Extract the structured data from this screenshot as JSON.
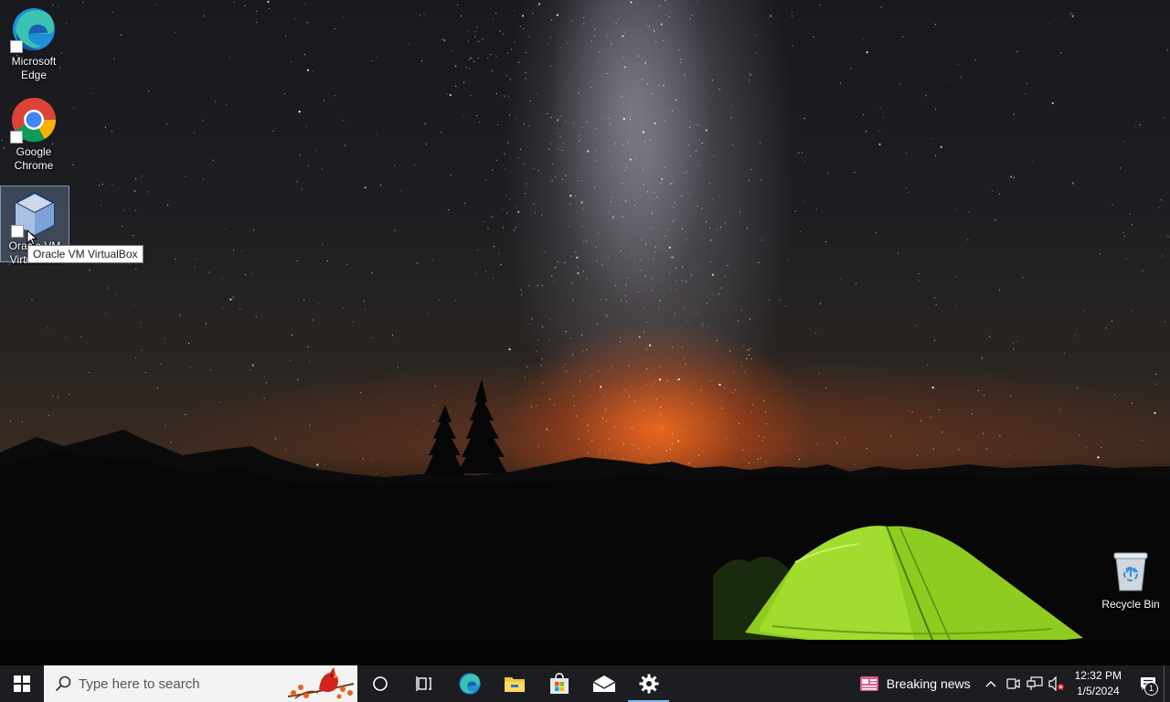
{
  "desktop": {
    "icons": [
      {
        "name": "edge",
        "label_line1": "Microsoft",
        "label_line2": "Edge"
      },
      {
        "name": "chrome",
        "label_line1": "Google",
        "label_line2": "Chrome"
      },
      {
        "name": "virtualbox",
        "label_line1": "Oracle VM",
        "label_line2": "VirtualBox"
      }
    ],
    "tooltip": "Oracle VM VirtualBox",
    "recycle_bin": "Recycle Bin"
  },
  "taskbar": {
    "search_placeholder": "Type here to search",
    "pinned": [
      "cortana-icon",
      "task-view-icon",
      "edge-icon",
      "file-explorer-icon",
      "store-icon",
      "mail-icon",
      "settings-icon"
    ],
    "news": "Breaking news",
    "time": "12:32 PM",
    "date": "1/5/2024",
    "notification_count": "1"
  },
  "colors": {
    "taskbar_bg": "#1c1d20",
    "tent_green": "#9bd82b",
    "active_indicator": "#7cb6ff"
  }
}
